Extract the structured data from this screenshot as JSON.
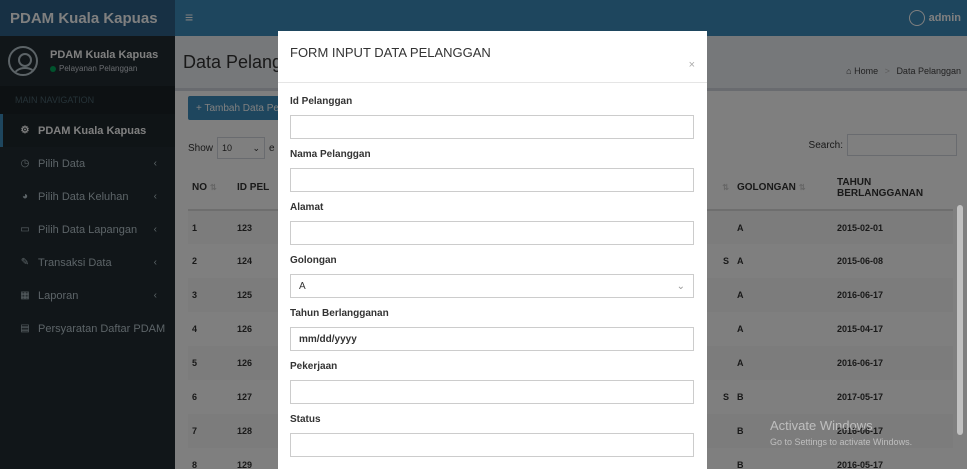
{
  "header": {
    "logo": "PDAM Kuala Kapuas",
    "menu_glyph": "≡",
    "user": "admin"
  },
  "sidebar": {
    "user_name": "PDAM Kuala Kapuas",
    "user_status": "Pelayanan Pelanggan",
    "nav_header": "MAIN NAVIGATION",
    "items": [
      {
        "label": "PDAM Kuala Kapuas",
        "icon": "dashboard-icon",
        "glyph": "⚙"
      },
      {
        "label": "Pilih Data",
        "icon": "clock-icon",
        "glyph": "◷",
        "caret": "‹"
      },
      {
        "label": "Pilih Data Keluhan",
        "icon": "pie-icon",
        "glyph": "◕",
        "caret": "‹"
      },
      {
        "label": "Pilih Data Lapangan",
        "icon": "laptop-icon",
        "glyph": "▭",
        "caret": "‹"
      },
      {
        "label": "Transaksi Data",
        "icon": "edit-icon",
        "glyph": "✎",
        "caret": "‹"
      },
      {
        "label": "Laporan",
        "icon": "table-icon",
        "glyph": "▦",
        "caret": "‹"
      },
      {
        "label": "Persyaratan Daftar PDAM",
        "icon": "book-icon",
        "glyph": "▤"
      }
    ]
  },
  "content": {
    "title": "Data Pelangg",
    "breadcrumb": {
      "home": "Home",
      "sep": ">",
      "current": "Data Pelanggan"
    },
    "add_button": "+ Tambah Data Pe",
    "show_label": "Show",
    "show_value": "10",
    "show_tail": "e",
    "search_label": "Search:",
    "table": {
      "headers": {
        "no": "NO",
        "id": "ID PEL",
        "golongan": "GOLONGAN",
        "tahun1": "TAHUN",
        "tahun2": "BERLANGGANAN"
      },
      "rows": [
        {
          "no": "1",
          "id": "123",
          "mid": "",
          "golongan": "A",
          "tahun": "2015-02-01"
        },
        {
          "no": "2",
          "id": "124",
          "mid": "S",
          "golongan": "A",
          "tahun": "2015-06-08"
        },
        {
          "no": "3",
          "id": "125",
          "mid": "",
          "golongan": "A",
          "tahun": "2016-06-17"
        },
        {
          "no": "4",
          "id": "126",
          "mid": "",
          "golongan": "A",
          "tahun": "2015-04-17"
        },
        {
          "no": "5",
          "id": "126",
          "mid": "",
          "golongan": "A",
          "tahun": "2016-06-17"
        },
        {
          "no": "6",
          "id": "127",
          "mid": "S",
          "golongan": "B",
          "tahun": "2017-05-17"
        },
        {
          "no": "7",
          "id": "128",
          "mid": "",
          "golongan": "B",
          "tahun": "2016-06-17"
        },
        {
          "no": "8",
          "id": "129",
          "mid": "",
          "golongan": "B",
          "tahun": "2016-05-17"
        }
      ]
    }
  },
  "modal": {
    "title": "FORM INPUT DATA PELANGGAN",
    "close": "×",
    "fields": {
      "id_pelanggan": {
        "label": "Id Pelanggan",
        "value": ""
      },
      "nama": {
        "label": "Nama Pelanggan",
        "value": ""
      },
      "alamat": {
        "label": "Alamat",
        "value": ""
      },
      "golongan": {
        "label": "Golongan",
        "value": "A"
      },
      "tahun": {
        "label": "Tahun Berlangganan",
        "placeholder": "mm/dd/yyyy"
      },
      "pekerjaan": {
        "label": "Pekerjaan",
        "value": ""
      },
      "status": {
        "label": "Status",
        "value": ""
      }
    }
  },
  "watermark": {
    "title": "Activate Windows",
    "subtitle": "Go to Settings to activate Windows."
  }
}
